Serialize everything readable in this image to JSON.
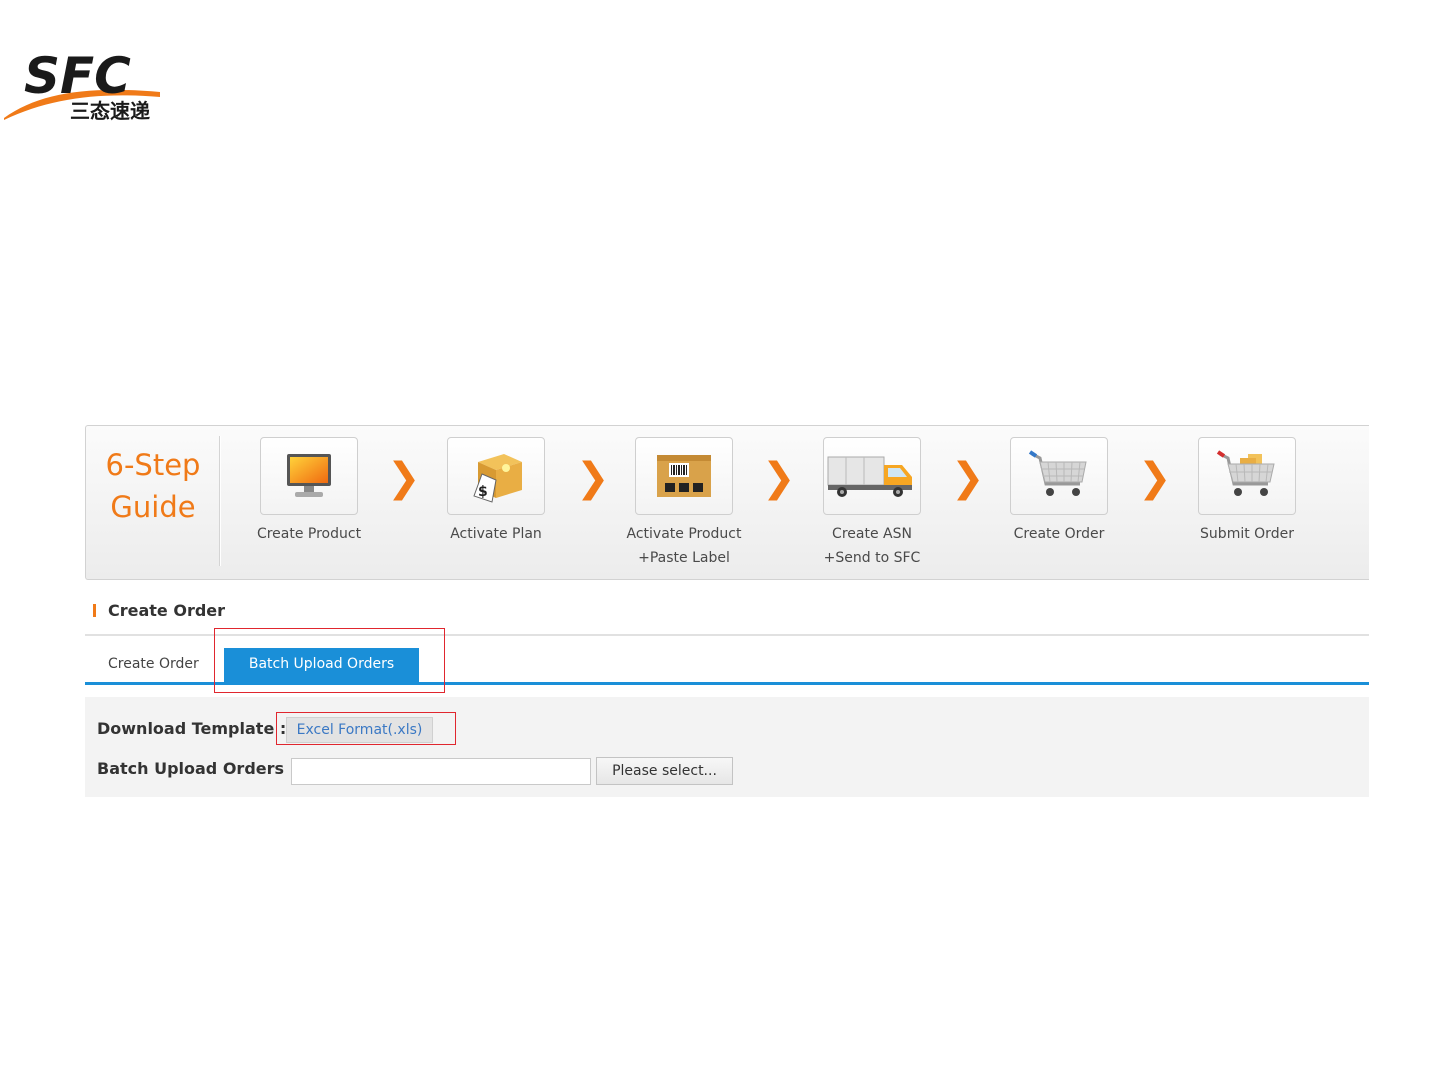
{
  "logo": {
    "brand": "SFC",
    "chinese": "三态速递"
  },
  "guide": {
    "title_line1": "6-Step",
    "title_line2": "Guide",
    "steps": [
      {
        "label": "Create Product",
        "icon": "monitor-icon"
      },
      {
        "label": "Activate Plan",
        "icon": "box-price-tag-icon"
      },
      {
        "label": "Activate Product\n+Paste Label",
        "icon": "labeled-box-icon"
      },
      {
        "label": "Create ASN\n+Send to SFC",
        "icon": "delivery-truck-icon"
      },
      {
        "label": "Create Order",
        "icon": "shopping-cart-icon"
      },
      {
        "label": "Submit Order",
        "icon": "full-cart-icon"
      }
    ],
    "separator": "❯"
  },
  "section": {
    "title": "Create Order"
  },
  "tabs": [
    {
      "label": "Create Order",
      "active": false
    },
    {
      "label": "Batch Upload Orders",
      "active": true
    }
  ],
  "upload": {
    "download_label": "Download Template :",
    "template_button": "Excel Format(.xls)",
    "batch_label": "Batch Upload Orders :",
    "file_value": "",
    "select_button": "Please select..."
  },
  "colors": {
    "accent_orange": "#f07a18",
    "tab_blue": "#1a8fd8",
    "highlight_red": "#e0262e"
  }
}
